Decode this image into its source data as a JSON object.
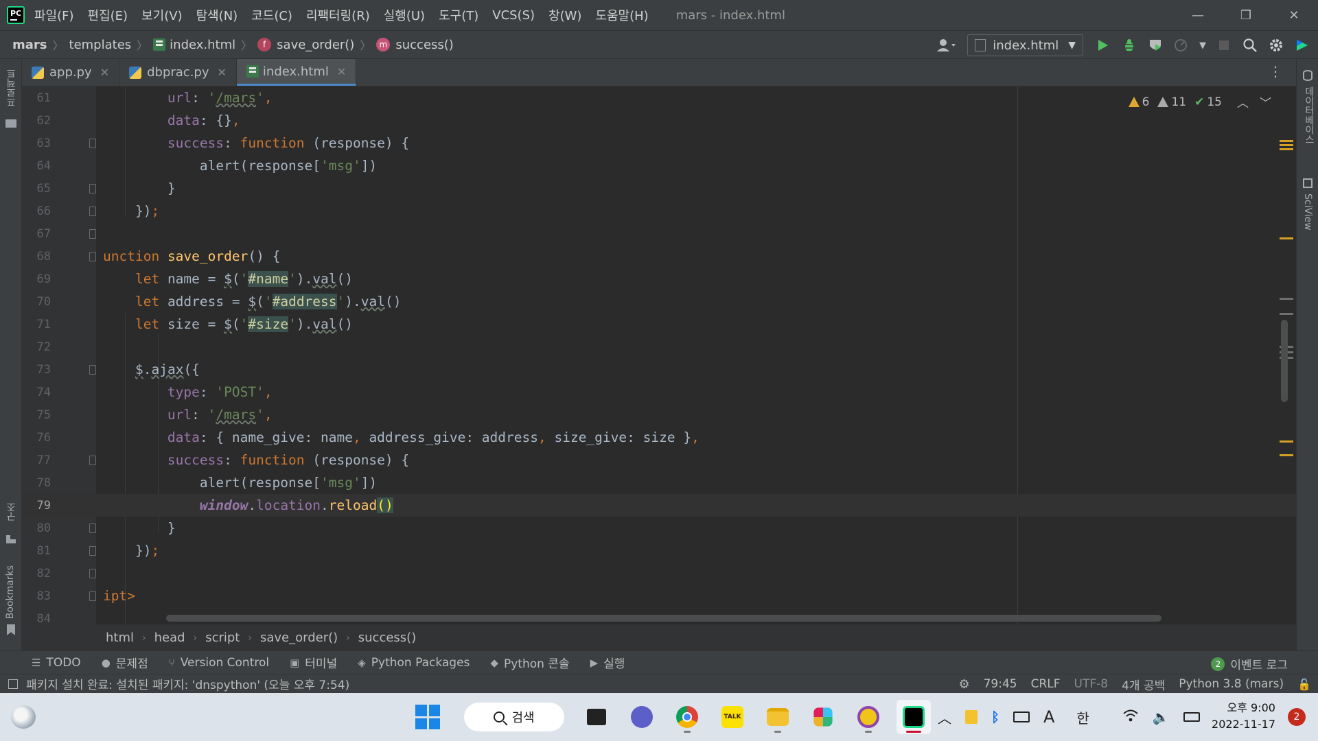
{
  "window": {
    "title": "mars - index.html",
    "logo_text": "PC",
    "minimize": "—",
    "restore": "❐",
    "close": "✕"
  },
  "menu": [
    {
      "label": "파일(F)"
    },
    {
      "label": "편집(E)"
    },
    {
      "label": "보기(V)"
    },
    {
      "label": "탐색(N)"
    },
    {
      "label": "코드(C)"
    },
    {
      "label": "리팩터링(R)"
    },
    {
      "label": "실행(U)"
    },
    {
      "label": "도구(T)"
    },
    {
      "label": "VCS(S)"
    },
    {
      "label": "창(W)"
    },
    {
      "label": "도움말(H)"
    }
  ],
  "navbar": {
    "root": "mars",
    "folder": "templates",
    "file": "index.html",
    "func_badge": "f",
    "func": "save_order()",
    "method_badge": "m",
    "method": "success()",
    "run_config": "index.html"
  },
  "tabs": [
    {
      "label": "app.py",
      "close": "✕"
    },
    {
      "label": "dbprac.py",
      "close": "✕"
    },
    {
      "label": "index.html",
      "close": "✕"
    }
  ],
  "inspections": {
    "warnings": "6",
    "weak_warnings": "11",
    "ok": "15"
  },
  "side_labels": {
    "project": "프로젝트",
    "structure": "구조",
    "bookmarks": "Bookmarks",
    "database": "데이터베이스",
    "sciview": "SciView"
  },
  "code": {
    "current_line": "79",
    "lines": [
      {
        "n": "61"
      },
      {
        "n": "62"
      },
      {
        "n": "63"
      },
      {
        "n": "64"
      },
      {
        "n": "65"
      },
      {
        "n": "66"
      },
      {
        "n": "67"
      },
      {
        "n": "68"
      },
      {
        "n": "69"
      },
      {
        "n": "70"
      },
      {
        "n": "71"
      },
      {
        "n": "72"
      },
      {
        "n": "73"
      },
      {
        "n": "74"
      },
      {
        "n": "75"
      },
      {
        "n": "76"
      },
      {
        "n": "77"
      },
      {
        "n": "78"
      },
      {
        "n": "79"
      },
      {
        "n": "80"
      },
      {
        "n": "81"
      },
      {
        "n": "82"
      },
      {
        "n": "83"
      },
      {
        "n": "84"
      }
    ]
  },
  "breadcrumb": [
    "html",
    "head",
    "script",
    "save_order()",
    "success()"
  ],
  "toolwindows": [
    {
      "label": "TODO",
      "icon": "☰"
    },
    {
      "label": "문제점",
      "icon": "●"
    },
    {
      "label": "Version Control",
      "icon": "⑂"
    },
    {
      "label": "터미널",
      "icon": "▣"
    },
    {
      "label": "Python Packages",
      "icon": "◈"
    },
    {
      "label": "Python 콘솔",
      "icon": "◆"
    },
    {
      "label": "실행",
      "icon": "▶"
    }
  ],
  "event_log": {
    "count": "2",
    "label": "이벤트 로그"
  },
  "status": {
    "message": "패키지 설치 완료: 설치된 패키지: 'dnspython' (오늘 오후 7:54)",
    "position": "79:45",
    "line_sep": "CRLF",
    "encoding": "UTF-8",
    "indent": "4개 공백",
    "interpreter": "Python 3.8 (mars)"
  },
  "taskbar": {
    "search_label": "검색",
    "ime": "한",
    "time": "오후 9:00",
    "date": "2022-11-17",
    "notifications": "2",
    "kakao": "TALK"
  }
}
